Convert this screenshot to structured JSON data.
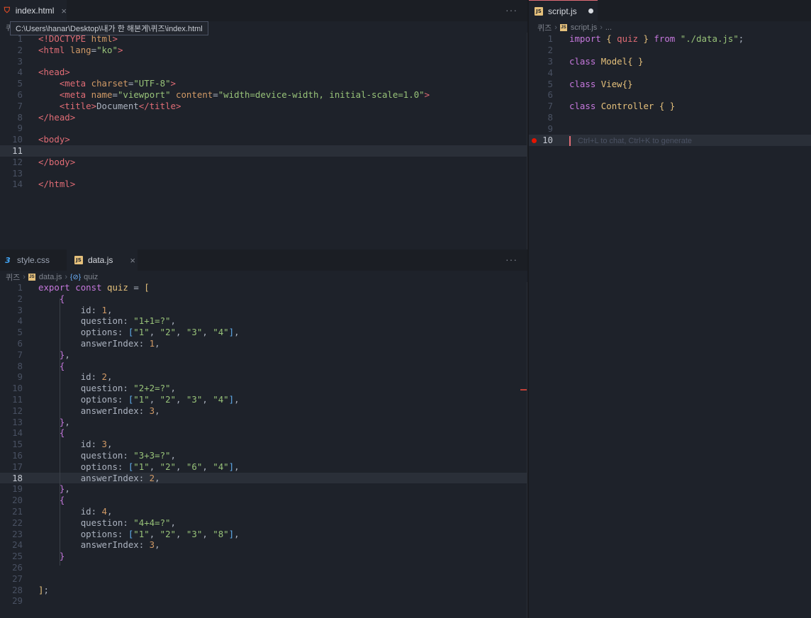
{
  "panes": {
    "index": {
      "tab": {
        "label": "index.html",
        "close": "×"
      },
      "more": "···",
      "tooltip": "C:\\Users\\hanar\\Desktop\\내가 한 해본게\\퀴즈\\index.html",
      "crumb_root": "퀴",
      "lines": [
        {
          "n": "1",
          "html": "<span class=\"t\">&lt;!DOCTYPE</span> <span class=\"a\">html</span><span class=\"t\">&gt;</span>"
        },
        {
          "n": "2",
          "html": "<span class=\"t\">&lt;html</span> <span class=\"a\">lang</span>=<span class=\"s\">\"ko\"</span><span class=\"t\">&gt;</span>"
        },
        {
          "n": "3",
          "html": ""
        },
        {
          "n": "4",
          "html": "<span class=\"t\">&lt;head&gt;</span>"
        },
        {
          "n": "5",
          "html": "    <span class=\"t\">&lt;meta</span> <span class=\"a\">charset</span>=<span class=\"s\">\"UTF-8\"</span><span class=\"t\">&gt;</span>"
        },
        {
          "n": "6",
          "html": "    <span class=\"t\">&lt;meta</span> <span class=\"a\">name</span>=<span class=\"s\">\"viewport\"</span> <span class=\"a\">content</span>=<span class=\"s\">\"width=device-width, initial-scale=1.0\"</span><span class=\"t\">&gt;</span>"
        },
        {
          "n": "7",
          "html": "    <span class=\"t\">&lt;title&gt;</span><span class=\"w\">Document</span><span class=\"t\">&lt;/title&gt;</span>"
        },
        {
          "n": "8",
          "html": "<span class=\"t\">&lt;/head&gt;</span>"
        },
        {
          "n": "9",
          "html": ""
        },
        {
          "n": "10",
          "html": "<span class=\"t\">&lt;body&gt;</span>"
        },
        {
          "n": "11",
          "html": "",
          "current": true
        },
        {
          "n": "12",
          "html": "<span class=\"t\">&lt;/body&gt;</span>"
        },
        {
          "n": "13",
          "html": ""
        },
        {
          "n": "14",
          "html": "<span class=\"t\">&lt;/html&gt;</span>"
        }
      ]
    },
    "data": {
      "tabs": [
        {
          "label": "style.css",
          "icon": "css"
        },
        {
          "label": "data.js",
          "icon": "js",
          "close": "×"
        }
      ],
      "more": "···",
      "breadcrumb": {
        "root": "퀴즈",
        "file": "data.js",
        "symbol": "quiz",
        "symbol_icon": "{⊘}"
      },
      "lines": [
        {
          "n": "1",
          "html": "<span class=\"k\">export</span> <span class=\"k\">const</span> <span class=\"y\">quiz</span> = <span class=\"c\">[</span>"
        },
        {
          "n": "2",
          "html": "    <span class=\"b\">{</span>"
        },
        {
          "n": "3",
          "html": "        <span class=\"w\">id</span>: <span class=\"n\">1</span>,"
        },
        {
          "n": "4",
          "html": "        <span class=\"w\">question</span>: <span class=\"s\">\"1+1=?\"</span>,"
        },
        {
          "n": "5",
          "html": "        <span class=\"w\">options</span>: <span class=\"bb\">[</span><span class=\"s\">\"1\"</span>, <span class=\"s\">\"2\"</span>, <span class=\"s\">\"3\"</span>, <span class=\"s\">\"4\"</span><span class=\"bb\">]</span>,"
        },
        {
          "n": "6",
          "html": "        <span class=\"w\">answerIndex</span>: <span class=\"n\">1</span>,"
        },
        {
          "n": "7",
          "html": "    <span class=\"b\">}</span>,"
        },
        {
          "n": "8",
          "html": "    <span class=\"b\">{</span>"
        },
        {
          "n": "9",
          "html": "        <span class=\"w\">id</span>: <span class=\"n\">2</span>,"
        },
        {
          "n": "10",
          "html": "        <span class=\"w\">question</span>: <span class=\"s\">\"2+2=?\"</span>,"
        },
        {
          "n": "11",
          "html": "        <span class=\"w\">options</span>: <span class=\"bb\">[</span><span class=\"s\">\"1\"</span>, <span class=\"s\">\"2\"</span>, <span class=\"s\">\"3\"</span>, <span class=\"s\">\"4\"</span><span class=\"bb\">]</span>,"
        },
        {
          "n": "12",
          "html": "        <span class=\"w\">answerIndex</span>: <span class=\"n\">3</span>,"
        },
        {
          "n": "13",
          "html": "    <span class=\"b\">}</span>,"
        },
        {
          "n": "14",
          "html": "    <span class=\"b\">{</span>"
        },
        {
          "n": "15",
          "html": "        <span class=\"w\">id</span>: <span class=\"n\">3</span>,"
        },
        {
          "n": "16",
          "html": "        <span class=\"w\">question</span>: <span class=\"s\">\"3+3=?\"</span>,"
        },
        {
          "n": "17",
          "html": "        <span class=\"w\">options</span>: <span class=\"bb\">[</span><span class=\"s\">\"1\"</span>, <span class=\"s\">\"2\"</span>, <span class=\"s\">\"6\"</span>, <span class=\"s\">\"4\"</span><span class=\"bb\">]</span>,"
        },
        {
          "n": "18",
          "html": "        <span class=\"w\">answerIndex</span>: <span class=\"n\">2</span>,",
          "current": true
        },
        {
          "n": "19",
          "html": "    <span class=\"b\">}</span>,"
        },
        {
          "n": "20",
          "html": "    <span class=\"b\">{</span>"
        },
        {
          "n": "21",
          "html": "        <span class=\"w\">id</span>: <span class=\"n\">4</span>,"
        },
        {
          "n": "22",
          "html": "        <span class=\"w\">question</span>: <span class=\"s\">\"4+4=?\"</span>,"
        },
        {
          "n": "23",
          "html": "        <span class=\"w\">options</span>: <span class=\"bb\">[</span><span class=\"s\">\"1\"</span>, <span class=\"s\">\"2\"</span>, <span class=\"s\">\"3\"</span>, <span class=\"s\">\"8\"</span><span class=\"bb\">]</span>,"
        },
        {
          "n": "24",
          "html": "        <span class=\"w\">answerIndex</span>: <span class=\"n\">3</span>,"
        },
        {
          "n": "25",
          "html": "    <span class=\"b\">}</span>"
        },
        {
          "n": "26",
          "html": ""
        },
        {
          "n": "27",
          "html": ""
        },
        {
          "n": "28",
          "html": "<span class=\"c\">]</span>;"
        },
        {
          "n": "29",
          "html": ""
        }
      ]
    },
    "script": {
      "tab": {
        "label": "script.js"
      },
      "breadcrumb": {
        "root": "퀴즈",
        "file": "script.js",
        "rest": "..."
      },
      "ghost_hint": "Ctrl+L to chat, Ctrl+K to generate",
      "lines": [
        {
          "n": "1",
          "html": "<span class=\"k\">import</span> <span class=\"c\">{</span> <span class=\"pr\">quiz</span> <span class=\"c\">}</span> <span class=\"k\">from</span> <span class=\"s\">\"./data.js\"</span>;"
        },
        {
          "n": "2",
          "html": ""
        },
        {
          "n": "3",
          "html": "<span class=\"k\">class</span> <span class=\"y\">Model</span><span class=\"c\">{ }</span>"
        },
        {
          "n": "4",
          "html": ""
        },
        {
          "n": "5",
          "html": "<span class=\"k\">class</span> <span class=\"y\">View</span><span class=\"c\">{}</span>"
        },
        {
          "n": "6",
          "html": ""
        },
        {
          "n": "7",
          "html": "<span class=\"k\">class</span> <span class=\"y\">Controller</span> <span class=\"c\">{ }</span>"
        },
        {
          "n": "8",
          "html": ""
        },
        {
          "n": "9",
          "html": ""
        },
        {
          "n": "10",
          "html": "",
          "current": true,
          "breakpoint": true,
          "ghost": true
        }
      ]
    }
  }
}
